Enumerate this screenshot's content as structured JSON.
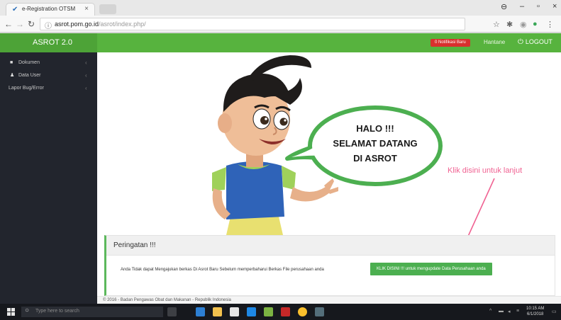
{
  "browser": {
    "tab_title": "e-Registration OTSM",
    "url_host": "asrot.pom.go.id",
    "url_path": "/asrot/index.php/"
  },
  "header": {
    "brand": "ASROT 2.0",
    "notification_badge": "0 Notifikasi Baru",
    "profile_link": "Hantane",
    "logout_label": "LOGOUT"
  },
  "sidebar": {
    "items": [
      {
        "label": "Dokumen",
        "icon": "file-icon"
      },
      {
        "label": "Data User",
        "icon": "user-icon"
      },
      {
        "label": "Lapor Bug/Error",
        "icon": ""
      }
    ]
  },
  "hero": {
    "bubble_lines": [
      "HALO !!!",
      "SELAMAT DATANG",
      "DI ASROT"
    ],
    "click_hint": "Klik disini untuk lanjut"
  },
  "warning": {
    "title": "Peringatan !!!",
    "text": "Anda Tidak dapat Mengajukan berkas Di Asrot Baru Sebelum memperbaharui Berkas File perusahaan anda",
    "button_label": "KLIK DISINI !!! untuk mengupdate Data Perusahaan anda"
  },
  "footer": {
    "text": "© 2016 - Badan Pengawas Obat dan Makanan - Republik Indonesia"
  },
  "taskbar": {
    "search_placeholder": "Type here to search",
    "time": "10:15 AM",
    "date": "6/1/2018"
  },
  "colors": {
    "header_green": "#57b33e",
    "sidebar_dark": "#22252d",
    "hint_pink": "#f06292",
    "badge_red": "#d9302e"
  }
}
